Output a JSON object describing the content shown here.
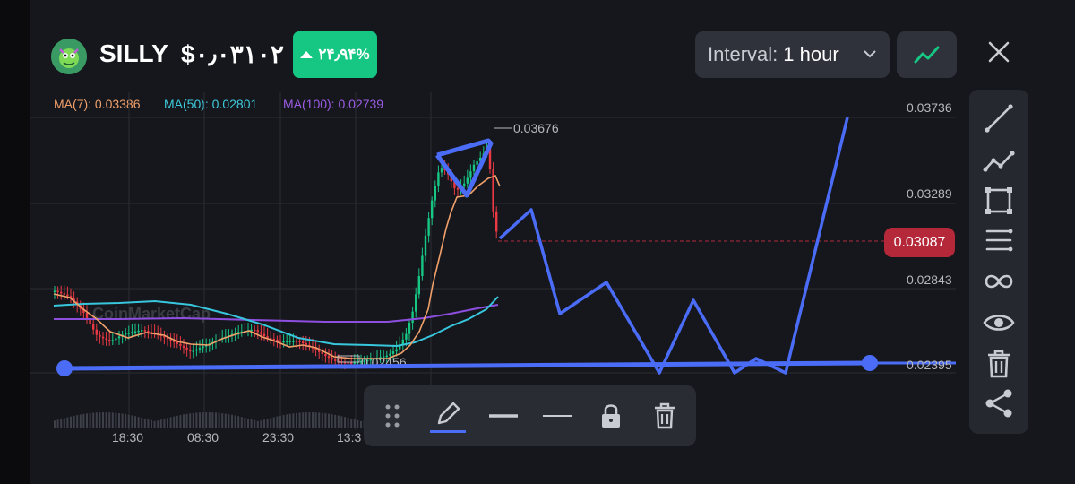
{
  "header": {
    "coin_name": "SILLY",
    "price": "$۰٫۰۳۱۰۲",
    "change": "۲۴٫۹۴%",
    "interval_label": "Interval:",
    "interval_value": "1 hour"
  },
  "moving_averages": [
    {
      "label": "MA(7): 0.03386",
      "color": "#f0a06a"
    },
    {
      "label": "MA(50): 0.02801",
      "color": "#3ec9dc"
    },
    {
      "label": "MA(100): 0.02739",
      "color": "#9b5de5"
    }
  ],
  "chart": {
    "price_levels": [
      "0.03736",
      "0.03289",
      "0.02843",
      "0.02395"
    ],
    "current_price": "0.03087",
    "high_label": "0.03676",
    "low_label": "0.02456",
    "time_labels": [
      "18:30",
      "08:30",
      "23:30",
      "13:3"
    ],
    "watermark": "CoinMarketCap"
  },
  "colors": {
    "up": "#16c784",
    "down": "#ea3943",
    "drawing": "#4a6cf7",
    "background": "#16171d"
  },
  "right_toolbar": [
    "trend-line-icon",
    "polyline-icon",
    "rectangle-icon",
    "parallel-lines-icon",
    "infinity-icon",
    "eye-icon",
    "trash-icon",
    "share-icon"
  ],
  "drawing_toolbar": [
    "drag-handle-icon",
    "pencil-icon",
    "line-solid-icon",
    "line-thin-icon",
    "lock-icon",
    "trash-icon"
  ]
}
